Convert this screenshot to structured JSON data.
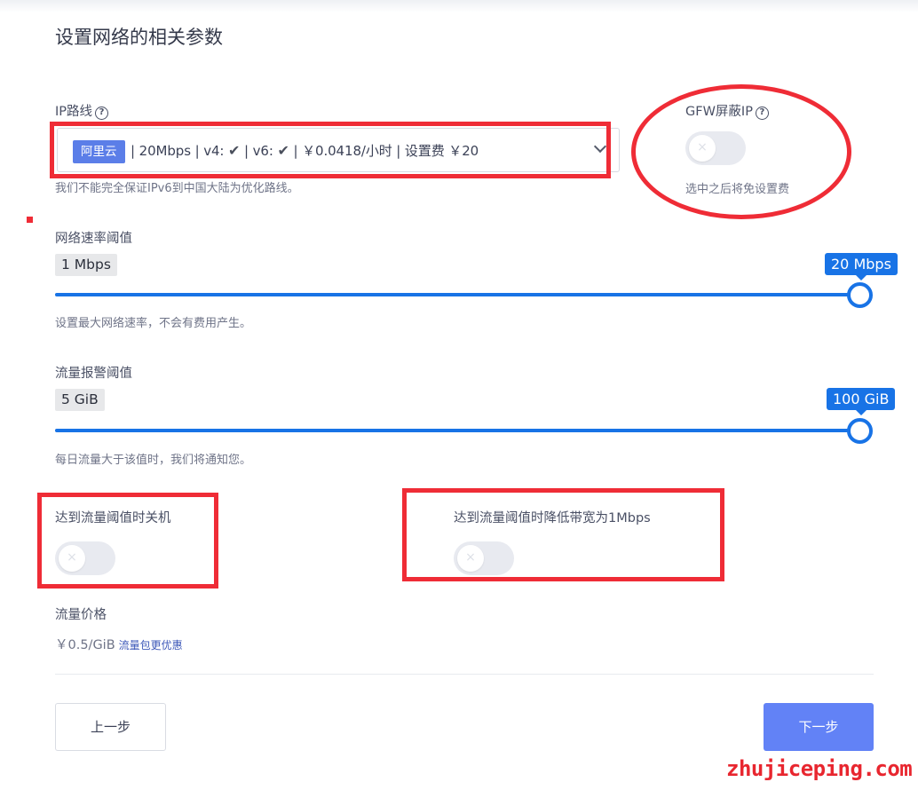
{
  "page": {
    "title": "设置网络的相关参数"
  },
  "ip_route": {
    "label": "IP路线",
    "help_icon": "question-circle-icon",
    "selected": {
      "tag": "阿里云",
      "text_a": "| 20Mbps | v4: ",
      "text_b": " | v6: ",
      "text_c": " |  ￥0.0418/小时 | 设置费 ￥20",
      "check_glyph": "✔"
    },
    "hint": "我们不能完全保证IPv6到中国大陆为优化路线。"
  },
  "gfw": {
    "label": "GFW屏蔽IP",
    "help_icon": "question-circle-icon",
    "enabled": false,
    "hint": "选中之后将免设置费"
  },
  "rate_limit": {
    "label": "网络速率阈值",
    "min_label": "1 Mbps",
    "value_label": "20 Mbps",
    "value_fraction": 1.0,
    "hint": "设置最大网络速率，不会有费用产生。"
  },
  "traffic_alert": {
    "label": "流量报警阈值",
    "min_label": "5 GiB",
    "value_label": "100 GiB",
    "value_fraction": 1.0,
    "hint": "每日流量大于该值时，我们将通知您。"
  },
  "shutdown_toggle": {
    "label": "达到流量阈值时关机",
    "enabled": false
  },
  "throttle_toggle": {
    "label": "达到流量阈值时降低带宽为1Mbps",
    "enabled": false
  },
  "traffic_price": {
    "label": "流量价格",
    "value": "￥0.5/GiB",
    "link": "流量包更优惠"
  },
  "buttons": {
    "prev": "上一步",
    "next": "下一步"
  },
  "watermark": "zhujiceping.com",
  "colors": {
    "accent": "#1873e6",
    "primary_button": "#6282f6",
    "annotation_red": "#ef2c36",
    "tag": "#5b7ee8"
  }
}
